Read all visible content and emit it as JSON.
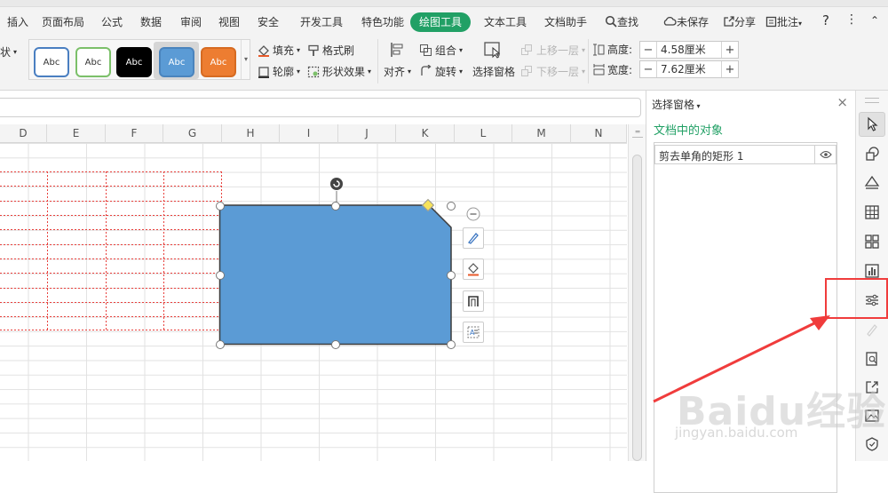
{
  "menu": {
    "items": [
      "插入",
      "页面布局",
      "公式",
      "数据",
      "审阅",
      "视图",
      "安全",
      "开发工具",
      "特色功能"
    ],
    "active_tab": "绘图工具",
    "items_after": [
      "文本工具",
      "文档助手"
    ],
    "search_label": "查找",
    "unsaved_label": "未保存",
    "share_label": "分享",
    "comment_label": "批注",
    "help_label": "?",
    "more_label": "⋮",
    "left_cut_label": "状"
  },
  "ribbon": {
    "styles": [
      {
        "label": "Abc",
        "bg": "#ffffff",
        "border": "#4a7fc1",
        "color": "#333333"
      },
      {
        "label": "Abc",
        "bg": "#ffffff",
        "border": "#7cc06a",
        "color": "#333333"
      },
      {
        "label": "Abc",
        "bg": "#000000",
        "border": "#000000",
        "color": "#ffffff"
      },
      {
        "label": "Abc",
        "bg": "#5b9bd5",
        "border": "#4a84bd",
        "color": "#ffffff"
      },
      {
        "label": "Abc",
        "bg": "#ed7d31",
        "border": "#d66b22",
        "color": "#ffffff"
      }
    ],
    "fill_label": "填充",
    "format_brush_label": "格式刷",
    "outline_label": "轮廓",
    "shape_effect_label": "形状效果",
    "align_label": "对齐",
    "group_label": "组合",
    "rotate_label": "旋转",
    "selection_pane_label": "选择窗格",
    "move_up_label": "上移一层",
    "move_down_label": "下移一层",
    "height_label": "高度:",
    "height_value": "4.58厘米",
    "width_label": "宽度:",
    "width_value": "7.62厘米",
    "minus": "−",
    "plus": "+"
  },
  "sheet": {
    "columns": [
      "D",
      "E",
      "F",
      "G",
      "H",
      "I",
      "J",
      "K",
      "L",
      "M",
      "N"
    ],
    "shape_fill": "#5b9bd5"
  },
  "pane": {
    "title": "选择窗格",
    "close": "×",
    "section_title": "文档中的对象",
    "items": [
      {
        "label": "剪去单角的矩形 1"
      }
    ]
  },
  "watermark": {
    "brand": "Baidu经验",
    "url": "jingyan.baidu.com"
  },
  "colors": {
    "accent": "#21a065",
    "highlight": "#f03c3c"
  }
}
